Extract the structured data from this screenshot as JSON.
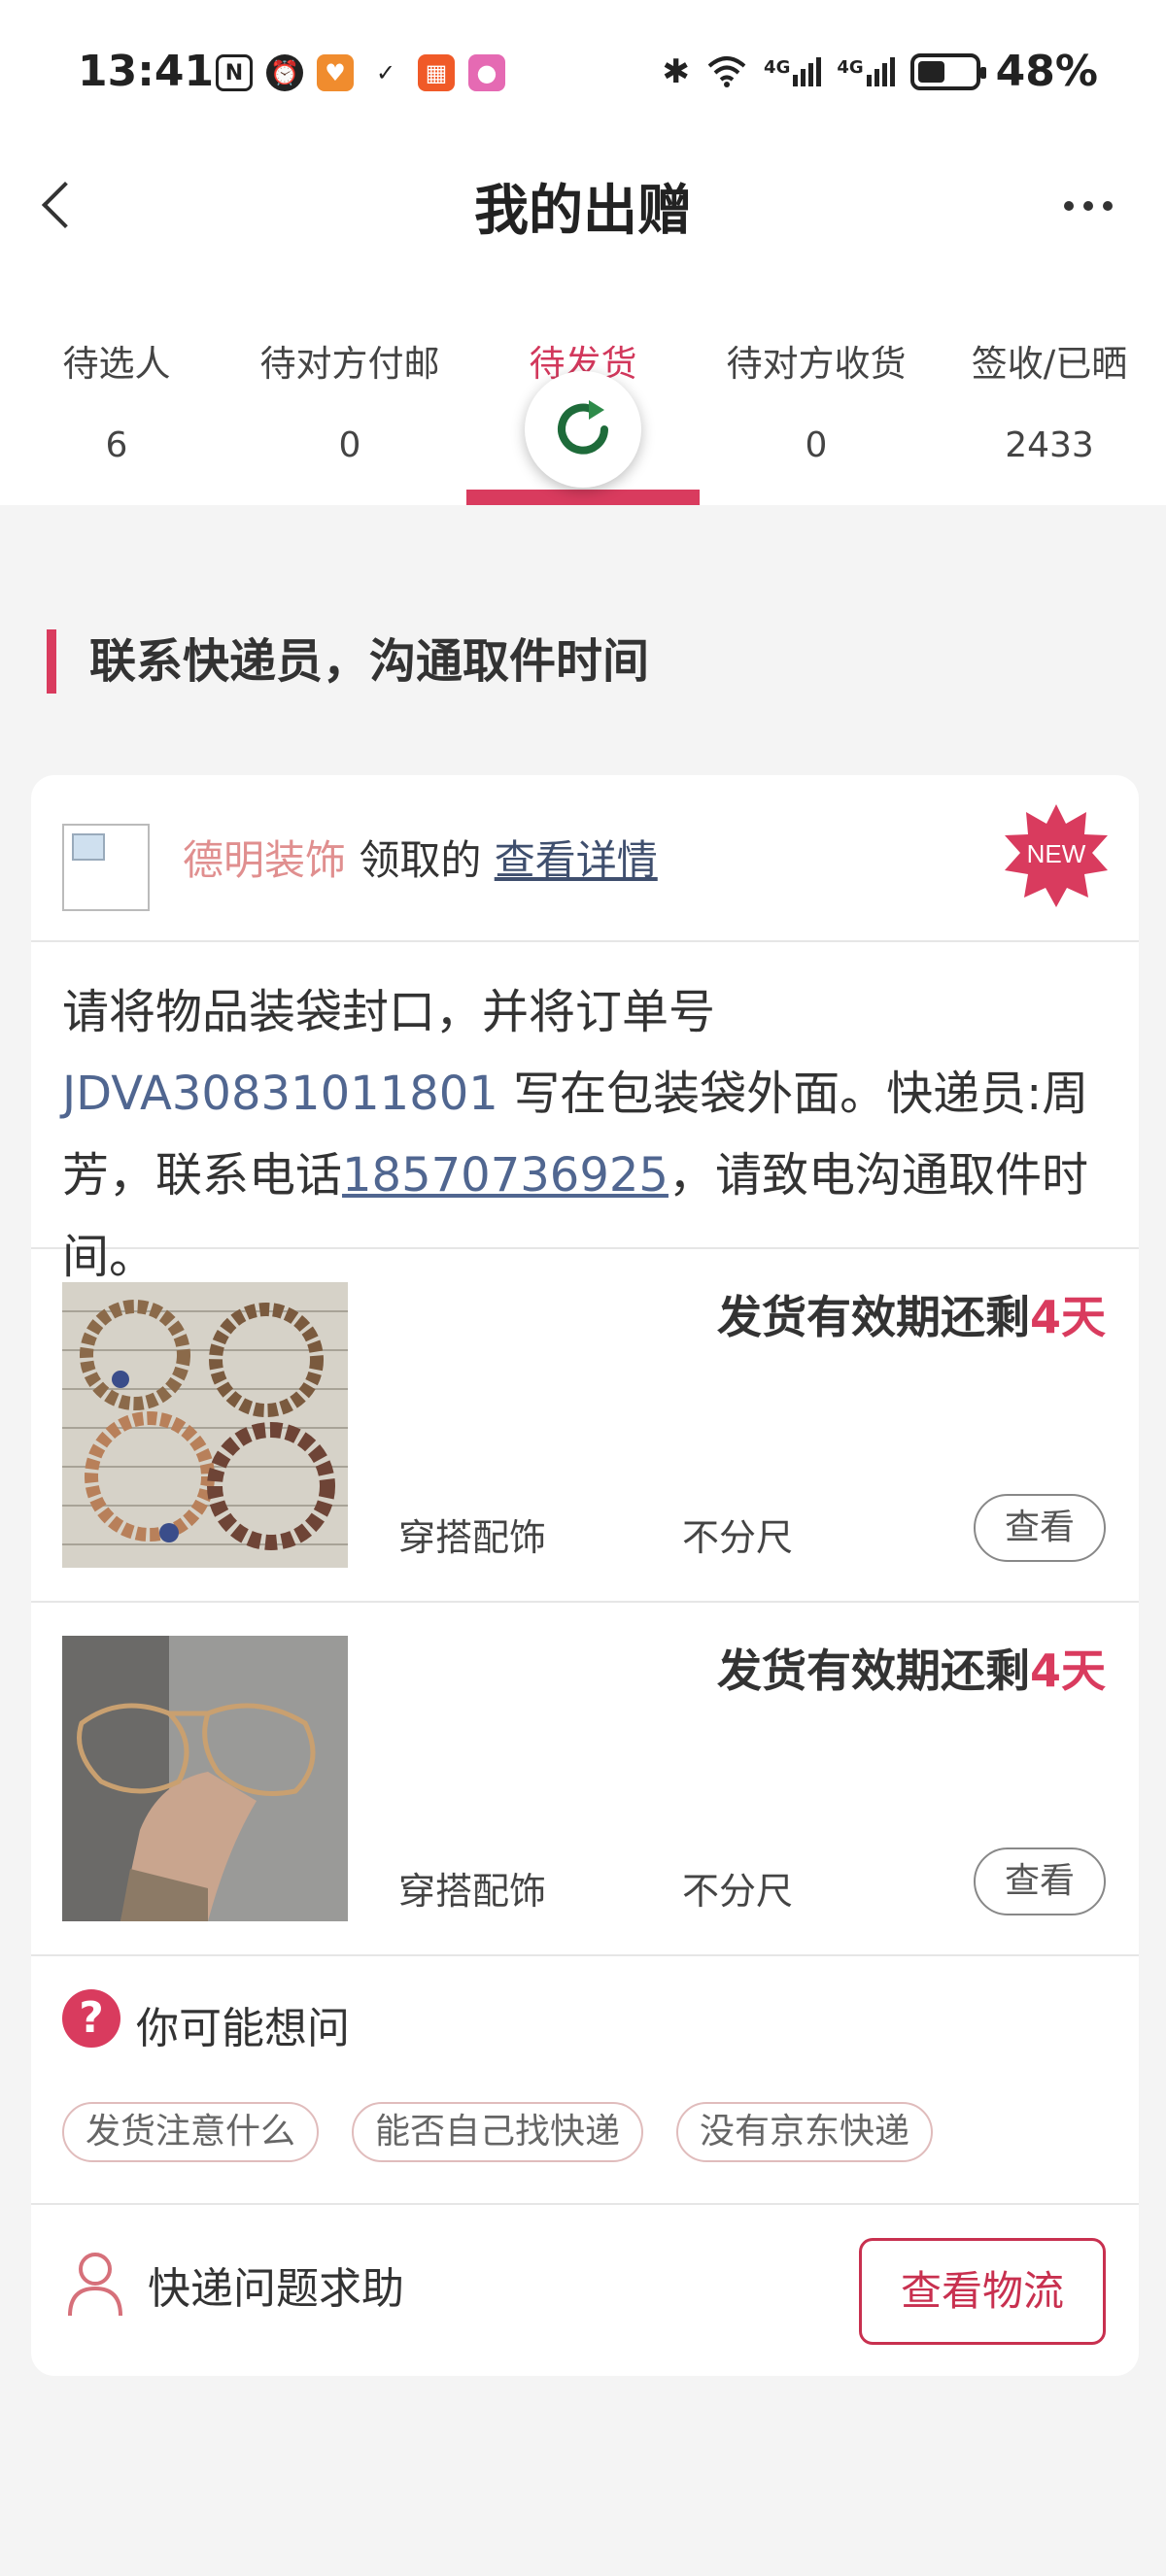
{
  "status_bar": {
    "time": "13:41",
    "battery_percent_label": "48%",
    "battery_level": 0.48,
    "network": [
      "4G",
      "4G"
    ],
    "icons": [
      "nfc-icon",
      "alarm-icon",
      "app-shield-icon",
      "app-link-icon",
      "app-store-icon",
      "app-camera-icon",
      "bluetooth-icon",
      "wifi-icon"
    ]
  },
  "nav": {
    "title": "我的出赠",
    "back_icon": "chevron-left-icon",
    "more_icon": "more-dots-icon"
  },
  "tabs": [
    {
      "label": "待选人",
      "count": "6"
    },
    {
      "label": "待对方付邮",
      "count": "0"
    },
    {
      "label": "待发货",
      "count": ""
    },
    {
      "label": "待对方收货",
      "count": "0"
    },
    {
      "label": "签收/已晒",
      "count": "2433"
    }
  ],
  "active_tab": "待发货",
  "section": {
    "title": "联系快递员，沟通取件时间"
  },
  "order": {
    "receiver_name": "德明装饰",
    "receiver_suffix": " 领取的 ",
    "detail_link": "查看详情",
    "badge": "NEW",
    "instruction_prefix": "请将物品装袋封口，并将订单号 ",
    "order_number": "JDVA30831011801",
    "instruction_mid": " 写在包装袋外面。快递员:周芳，联系电话",
    "phone": "18570736925",
    "instruction_suffix": "，请致电沟通取件时间。",
    "items": [
      {
        "deadline_prefix": "发货有效期还剩",
        "deadline_days": "4天",
        "category": "穿搭配饰",
        "size": "不分尺",
        "view_label": "查看"
      },
      {
        "deadline_prefix": "发货有效期还剩",
        "deadline_days": "4天",
        "category": "穿搭配饰",
        "size": "不分尺",
        "view_label": "查看"
      }
    ]
  },
  "faq": {
    "title": "你可能想问",
    "icon": "?",
    "tags": [
      "发货注意什么",
      "能否自己找快递",
      "没有京东快递"
    ]
  },
  "footer": {
    "help_label": "快递问题求助",
    "logistics_button": "查看物流"
  },
  "colors": {
    "accent": "#d93b5e",
    "link": "#506690",
    "receiver": "#e08f8f",
    "background": "#f4f4f4"
  }
}
